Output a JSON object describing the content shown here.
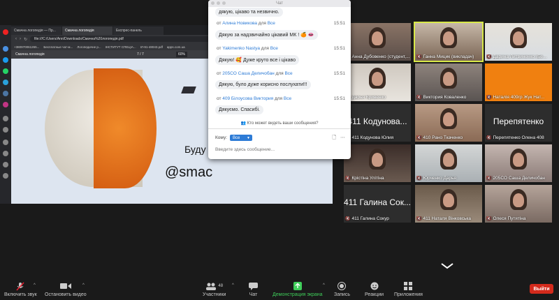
{
  "browser": {
    "tabs": [
      "Смачна логопедія — Пр...",
      "Смачна логопедія",
      "Експрес-панель"
    ],
    "url": "file:///C:/Users/Ann/Downloads/Смачна%20логопедія.pdf",
    "bookmarks": [
      "+380970061265...",
      "Бесплатные чат-м...",
      "Логопедичне р...",
      "ІНСТИТУТ СПЕЦІА...",
      "ІЛ-91-48043.pdf",
      "apps.com.ua"
    ],
    "pdf_title": "Смачна логопедія",
    "page_current": "7",
    "page_total": "7",
    "zoom": "60%",
    "slide_line1": "Буду р",
    "slide_line2": "@smac"
  },
  "chat": {
    "title": "Чат",
    "prev_bubble": "дякую, цікаво та незвичнo.",
    "prefix": "от",
    "for": "для",
    "messages": [
      {
        "sender": "Алина Новикова",
        "to": "Все",
        "time": "15:51",
        "text": "Дякую за надзвичайно цікавий МК ! 🍊 👄"
      },
      {
        "sender": "Yakimenko Nastya",
        "to": "Все",
        "time": "15:51",
        "text": "Дякую! 🥰 Дуже круто все і цікаво"
      },
      {
        "sender": "205CO Саша Деличобан",
        "to": "Все",
        "time": "15:51",
        "text": "Дякую, було дуже корисно послухати!!!"
      },
      {
        "sender": "409 Білоусова Виктория",
        "to": "Все",
        "time": "15:51",
        "text": "Дякуємо. Спасибі."
      }
    ],
    "who_can_see": "Кто может видеть ваши сообщения?",
    "to_label": "Кому:",
    "to_value": "Все",
    "placeholder": "Введите здесь сообщение..."
  },
  "participants": [
    {
      "name": "Анна Дубовенко (студент,...",
      "video": true
    },
    {
      "name": "Ганна Мицик (викладач)",
      "video": true
    },
    {
      "name": "Дарина Литвиненко (Бе...",
      "video": true
    },
    {
      "name": "Дарья Кривенко",
      "video": true
    },
    {
      "name": "Виктория Коваленко",
      "video": true
    },
    {
      "name": "Наталія 409гр Жук Нат...",
      "video": false
    },
    {
      "name": "411 Кодунова Юлия",
      "big": "411 Кодунова...",
      "video": false
    },
    {
      "name": "410 Рано Ткаченко",
      "video": true
    },
    {
      "name": "Перепятенко Олена 408",
      "big": "Перепятенко",
      "video": false
    },
    {
      "name": "Крістіна Улітіна",
      "video": true
    },
    {
      "name": "Юрченко Дарья",
      "video": true
    },
    {
      "name": "205CO Саша Деличобан",
      "video": true
    },
    {
      "name": "411 Галина Сокур",
      "big": "411 Галина Сок...",
      "video": false
    },
    {
      "name": "411 Наталя Вінковська",
      "video": true
    },
    {
      "name": "Олеся Путятіна",
      "video": true
    }
  ],
  "toolbar": {
    "unmute": "Включить звук",
    "video": "Остановить видео",
    "participants": "Участники",
    "participants_count": "48",
    "chat": "Чат",
    "share": "Демонстрация экрана",
    "record": "Запись",
    "reactions": "Реакции",
    "apps": "Приложения",
    "leave": "Выйти"
  },
  "colors": {
    "accent": "#2d7bd6",
    "share_green": "#3fce5a",
    "leave_red": "#d32a1c",
    "highlight": "#d8e848"
  }
}
